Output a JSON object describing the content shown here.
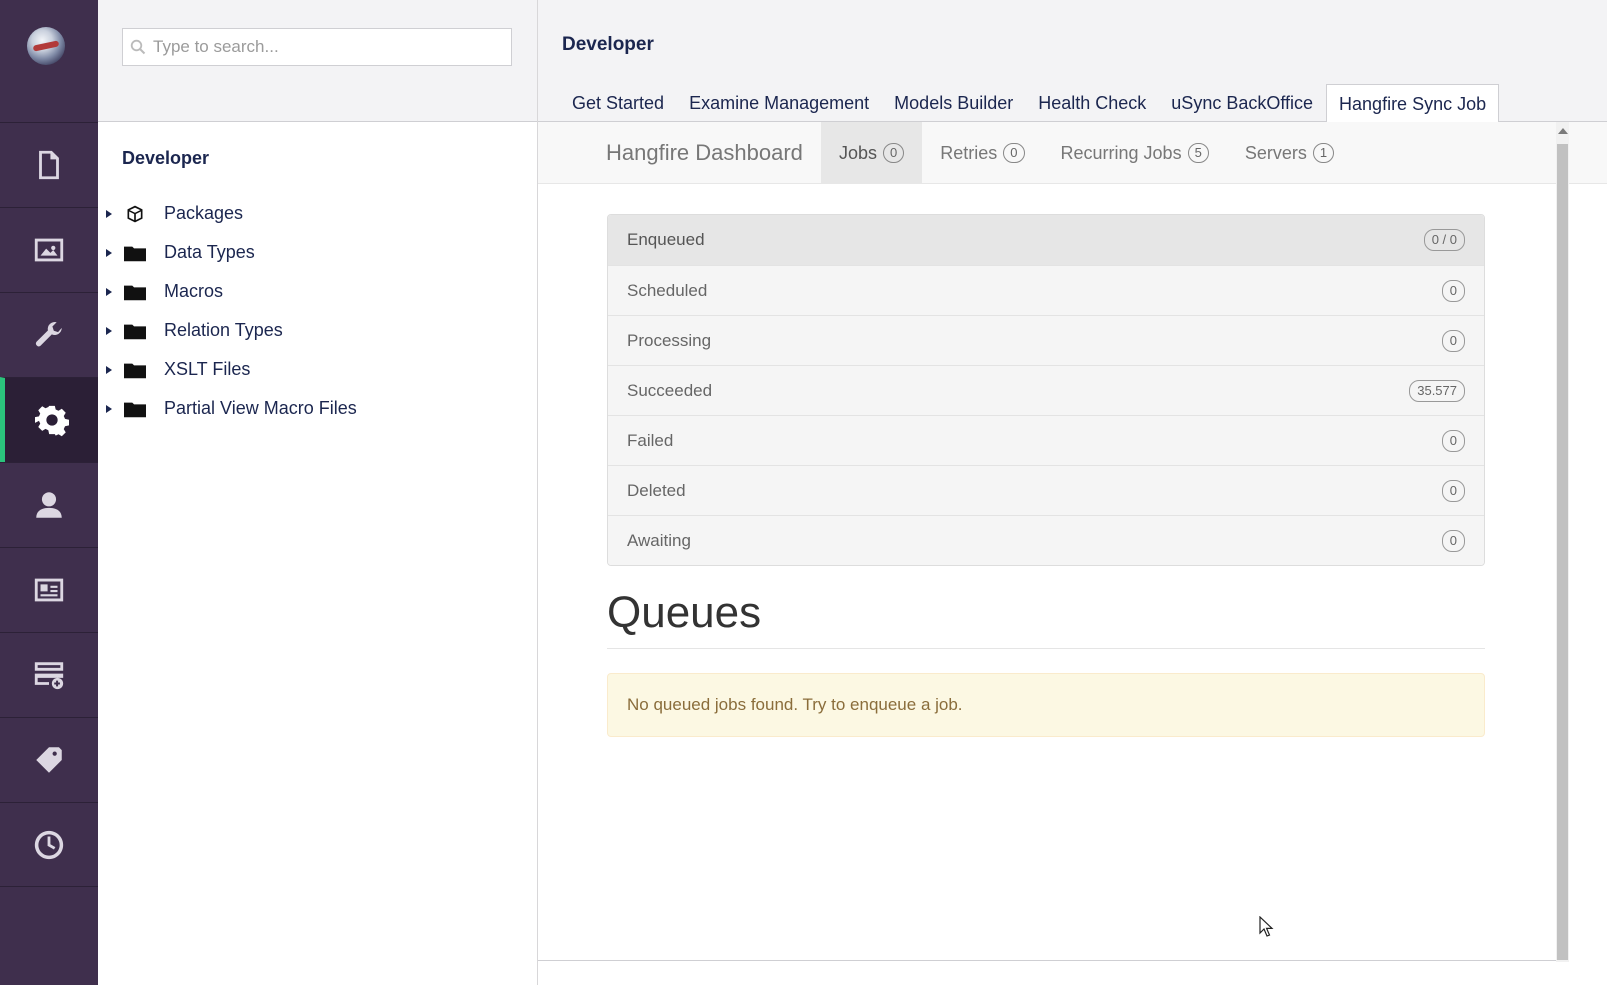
{
  "search": {
    "placeholder": "Type to search..."
  },
  "tree": {
    "title": "Developer",
    "items": [
      {
        "label": "Packages",
        "icon": "package-icon"
      },
      {
        "label": "Data Types",
        "icon": "folder-icon"
      },
      {
        "label": "Macros",
        "icon": "folder-icon"
      },
      {
        "label": "Relation Types",
        "icon": "folder-icon"
      },
      {
        "label": "XSLT Files",
        "icon": "folder-icon"
      },
      {
        "label": "Partial View Macro Files",
        "icon": "folder-icon"
      }
    ]
  },
  "header": {
    "title": "Developer",
    "tabs": [
      {
        "label": "Get Started"
      },
      {
        "label": "Examine Management"
      },
      {
        "label": "Models Builder"
      },
      {
        "label": "Health Check"
      },
      {
        "label": "uSync BackOffice"
      },
      {
        "label": "Hangfire Sync Job",
        "active": true
      }
    ]
  },
  "hangfire": {
    "brand": "Hangfire Dashboard",
    "nav": [
      {
        "label": "Jobs",
        "count": "0",
        "active": true
      },
      {
        "label": "Retries",
        "count": "0"
      },
      {
        "label": "Recurring Jobs",
        "count": "5"
      },
      {
        "label": "Servers",
        "count": "1"
      }
    ],
    "states": [
      {
        "label": "Enqueued",
        "count": "0 / 0"
      },
      {
        "label": "Scheduled",
        "count": "0"
      },
      {
        "label": "Processing",
        "count": "0"
      },
      {
        "label": "Succeeded",
        "count": "35.577"
      },
      {
        "label": "Failed",
        "count": "0"
      },
      {
        "label": "Deleted",
        "count": "0"
      },
      {
        "label": "Awaiting",
        "count": "0"
      }
    ],
    "queues_title": "Queues",
    "empty_message": "No queued jobs found. Try to enqueue a job."
  },
  "colors": {
    "rail": "#3f2f4d",
    "accent": "#2bc37c",
    "alert_bg": "#fcf8e3"
  },
  "rail_icons": [
    "document-icon",
    "image-icon",
    "wrench-icon",
    "gear-icon",
    "user-icon",
    "id-card-icon",
    "form-icon",
    "tag-icon",
    "clock-icon"
  ]
}
